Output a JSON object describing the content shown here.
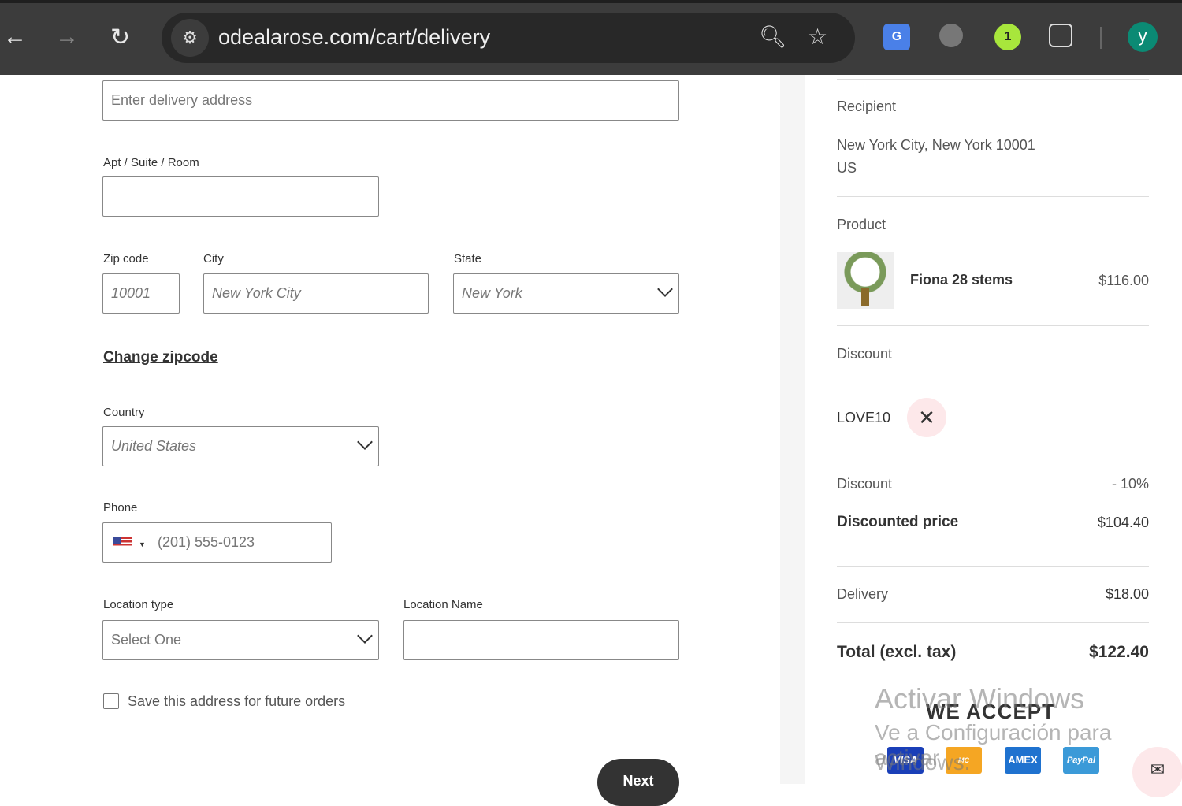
{
  "browser": {
    "url": "odealarose.com/cart/delivery",
    "extension_badge": "1",
    "profile_initial": "y"
  },
  "form": {
    "address_placeholder": "Enter delivery address",
    "apt_label": "Apt / Suite / Room",
    "zip_label": "Zip code",
    "zip_value": "10001",
    "city_label": "City",
    "city_value": "New York City",
    "state_label": "State",
    "state_value": "New York",
    "change_zip": "Change zipcode",
    "country_label": "Country",
    "country_value": "United States",
    "phone_label": "Phone",
    "phone_placeholder": "(201) 555-0123",
    "location_type_label": "Location type",
    "location_type_value": "Select One",
    "location_name_label": "Location Name",
    "save_address_label": "Save this address for future orders",
    "next_label": "Next"
  },
  "summary": {
    "recipient_label": "Recipient",
    "recipient_line1": "New York City, New York 10001",
    "recipient_line2": "US",
    "product_label": "Product",
    "product_name": "Fiona 28 stems",
    "product_price": "$116.00",
    "discount_label": "Discount",
    "discount_code": "LOVE10",
    "discount_row_label": "Discount",
    "discount_row_value": "- 10%",
    "discounted_label": "Discounted price",
    "discounted_value": "$104.40",
    "delivery_label": "Delivery",
    "delivery_value": "$18.00",
    "total_label": "Total (excl. tax)",
    "total_value": "$122.40",
    "we_accept": "WE ACCEPT",
    "cards": [
      "VISA",
      "MC",
      "AMEX",
      "PayPal"
    ]
  },
  "watermark": {
    "line1": "Activar Windows",
    "line2": "Ve a Configuración para activar",
    "line3": "Windows."
  }
}
